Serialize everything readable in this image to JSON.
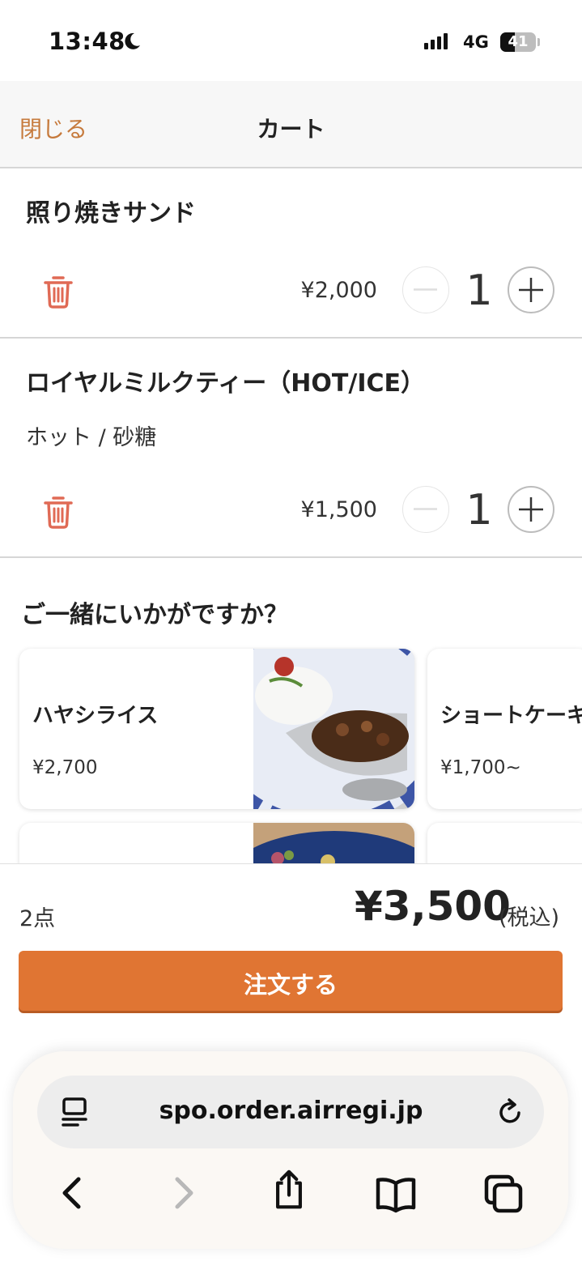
{
  "status_bar": {
    "time": "13:48",
    "network": "4G",
    "battery": "41"
  },
  "header": {
    "close_label": "閉じる",
    "title": "カート"
  },
  "cart": {
    "items": [
      {
        "name": "照り焼きサンド",
        "price": "¥2,000",
        "quantity": "1"
      },
      {
        "name": "ロイヤルミルクティー（HOT/ICE）",
        "options": "ホット / 砂糖",
        "price": "¥1,500",
        "quantity": "1"
      }
    ]
  },
  "suggestions": {
    "title": "ご一緒にいかがですか？",
    "cards": [
      {
        "name": "ハヤシライス",
        "price": "¥2,700"
      },
      {
        "name": "ショートケーキ",
        "price": "¥1,700~"
      }
    ]
  },
  "summary": {
    "count": "2点",
    "total": "¥3,500",
    "tax_note": "(税込)",
    "order_label": "注文する"
  },
  "browser": {
    "url": "spo.order.airregi.jp"
  },
  "colors": {
    "accent": "#e07533",
    "close_link": "#c67a3c",
    "trash": "#e06a55"
  }
}
